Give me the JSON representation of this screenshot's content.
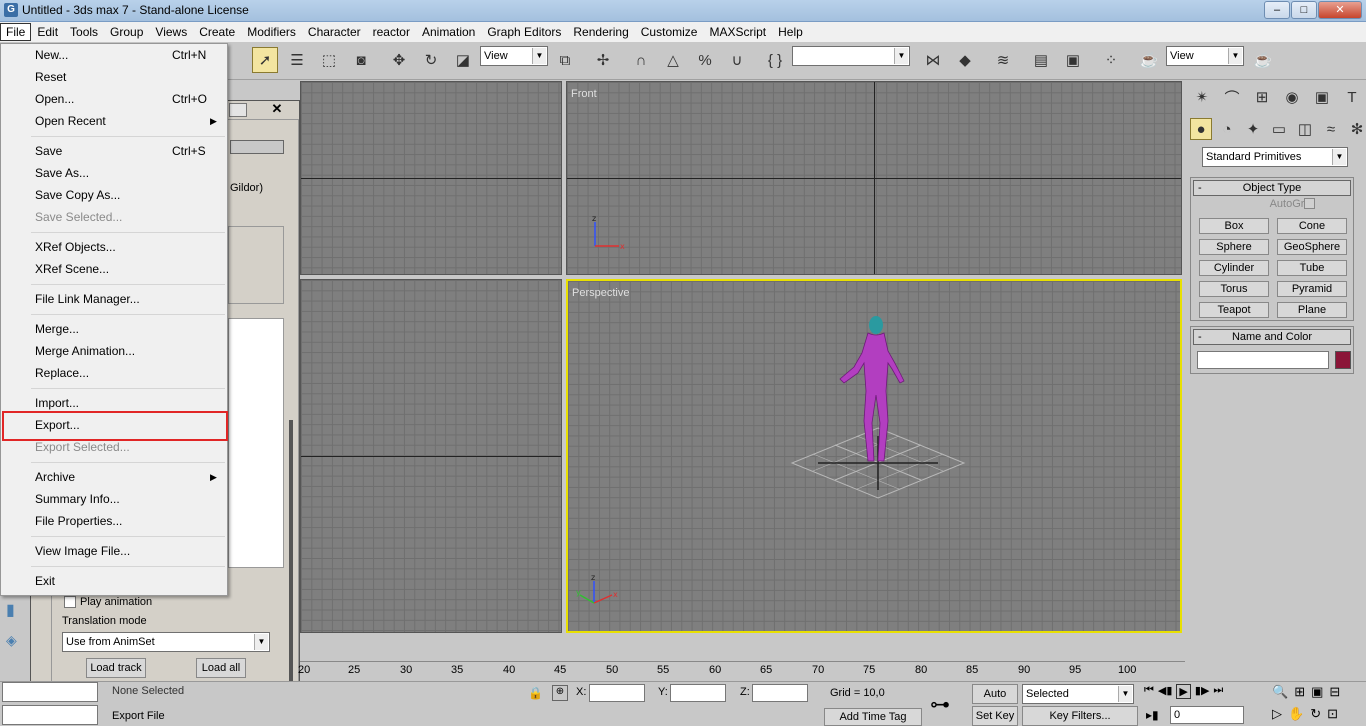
{
  "window": {
    "title": "Untitled - 3ds max 7 - Stand-alone License",
    "logo": "G",
    "min": "–",
    "max": "□",
    "close": "✕"
  },
  "menubar": [
    "File",
    "Edit",
    "Tools",
    "Group",
    "Views",
    "Create",
    "Modifiers",
    "Character",
    "reactor",
    "Animation",
    "Graph Editors",
    "Rendering",
    "Customize",
    "MAXScript",
    "Help"
  ],
  "toolbar": {
    "view_select": "View",
    "view_select2": "View"
  },
  "file_menu": {
    "new": "New...",
    "new_sc": "Ctrl+N",
    "reset": "Reset",
    "open": "Open...",
    "open_sc": "Ctrl+O",
    "open_recent": "Open Recent",
    "save": "Save",
    "save_sc": "Ctrl+S",
    "save_as": "Save As...",
    "save_copy": "Save Copy As...",
    "save_selected": "Save Selected...",
    "xref_objects": "XRef Objects...",
    "xref_scene": "XRef Scene...",
    "file_link": "File Link Manager...",
    "merge": "Merge...",
    "merge_anim": "Merge Animation...",
    "replace": "Replace...",
    "import": "Import...",
    "export": "Export...",
    "export_selected": "Export Selected...",
    "archive": "Archive",
    "summary": "Summary Info...",
    "file_props": "File Properties...",
    "view_image": "View Image File...",
    "exit": "Exit"
  },
  "viewports": {
    "front": "Front",
    "perspective": "Perspective",
    "accent": "#e8e000",
    "figure_color": "#b23ec0"
  },
  "dialog": {
    "author_fragment": "Gildor)",
    "play_animation": "Play animation",
    "translation_mode": "Translation mode",
    "translation_value": "Use from AnimSet",
    "load_track": "Load track",
    "load_all": "Load all"
  },
  "command_panel": {
    "category": "Standard Primitives",
    "object_type": "Object Type",
    "autogrid": "AutoGrid",
    "objects": [
      "Box",
      "Cone",
      "Sphere",
      "GeoSphere",
      "Cylinder",
      "Tube",
      "Torus",
      "Pyramid",
      "Teapot",
      "Plane"
    ],
    "name_and_color": "Name and Color",
    "swatch_color": "#8b1538"
  },
  "trackbar_ticks": [
    "20",
    "25",
    "30",
    "35",
    "40",
    "45",
    "50",
    "55",
    "60",
    "65",
    "70",
    "75",
    "80",
    "85",
    "90",
    "95",
    "100"
  ],
  "status": {
    "none_selected": "None Selected",
    "export_file": "Export File",
    "x": "X:",
    "y": "Y:",
    "z": "Z:",
    "grid": "Grid = 10,0",
    "add_time_tag": "Add Time Tag",
    "auto_key": "Auto Key",
    "set_key": "Set Key",
    "selected": "Selected",
    "key_filters": "Key Filters...",
    "frame": "0"
  }
}
